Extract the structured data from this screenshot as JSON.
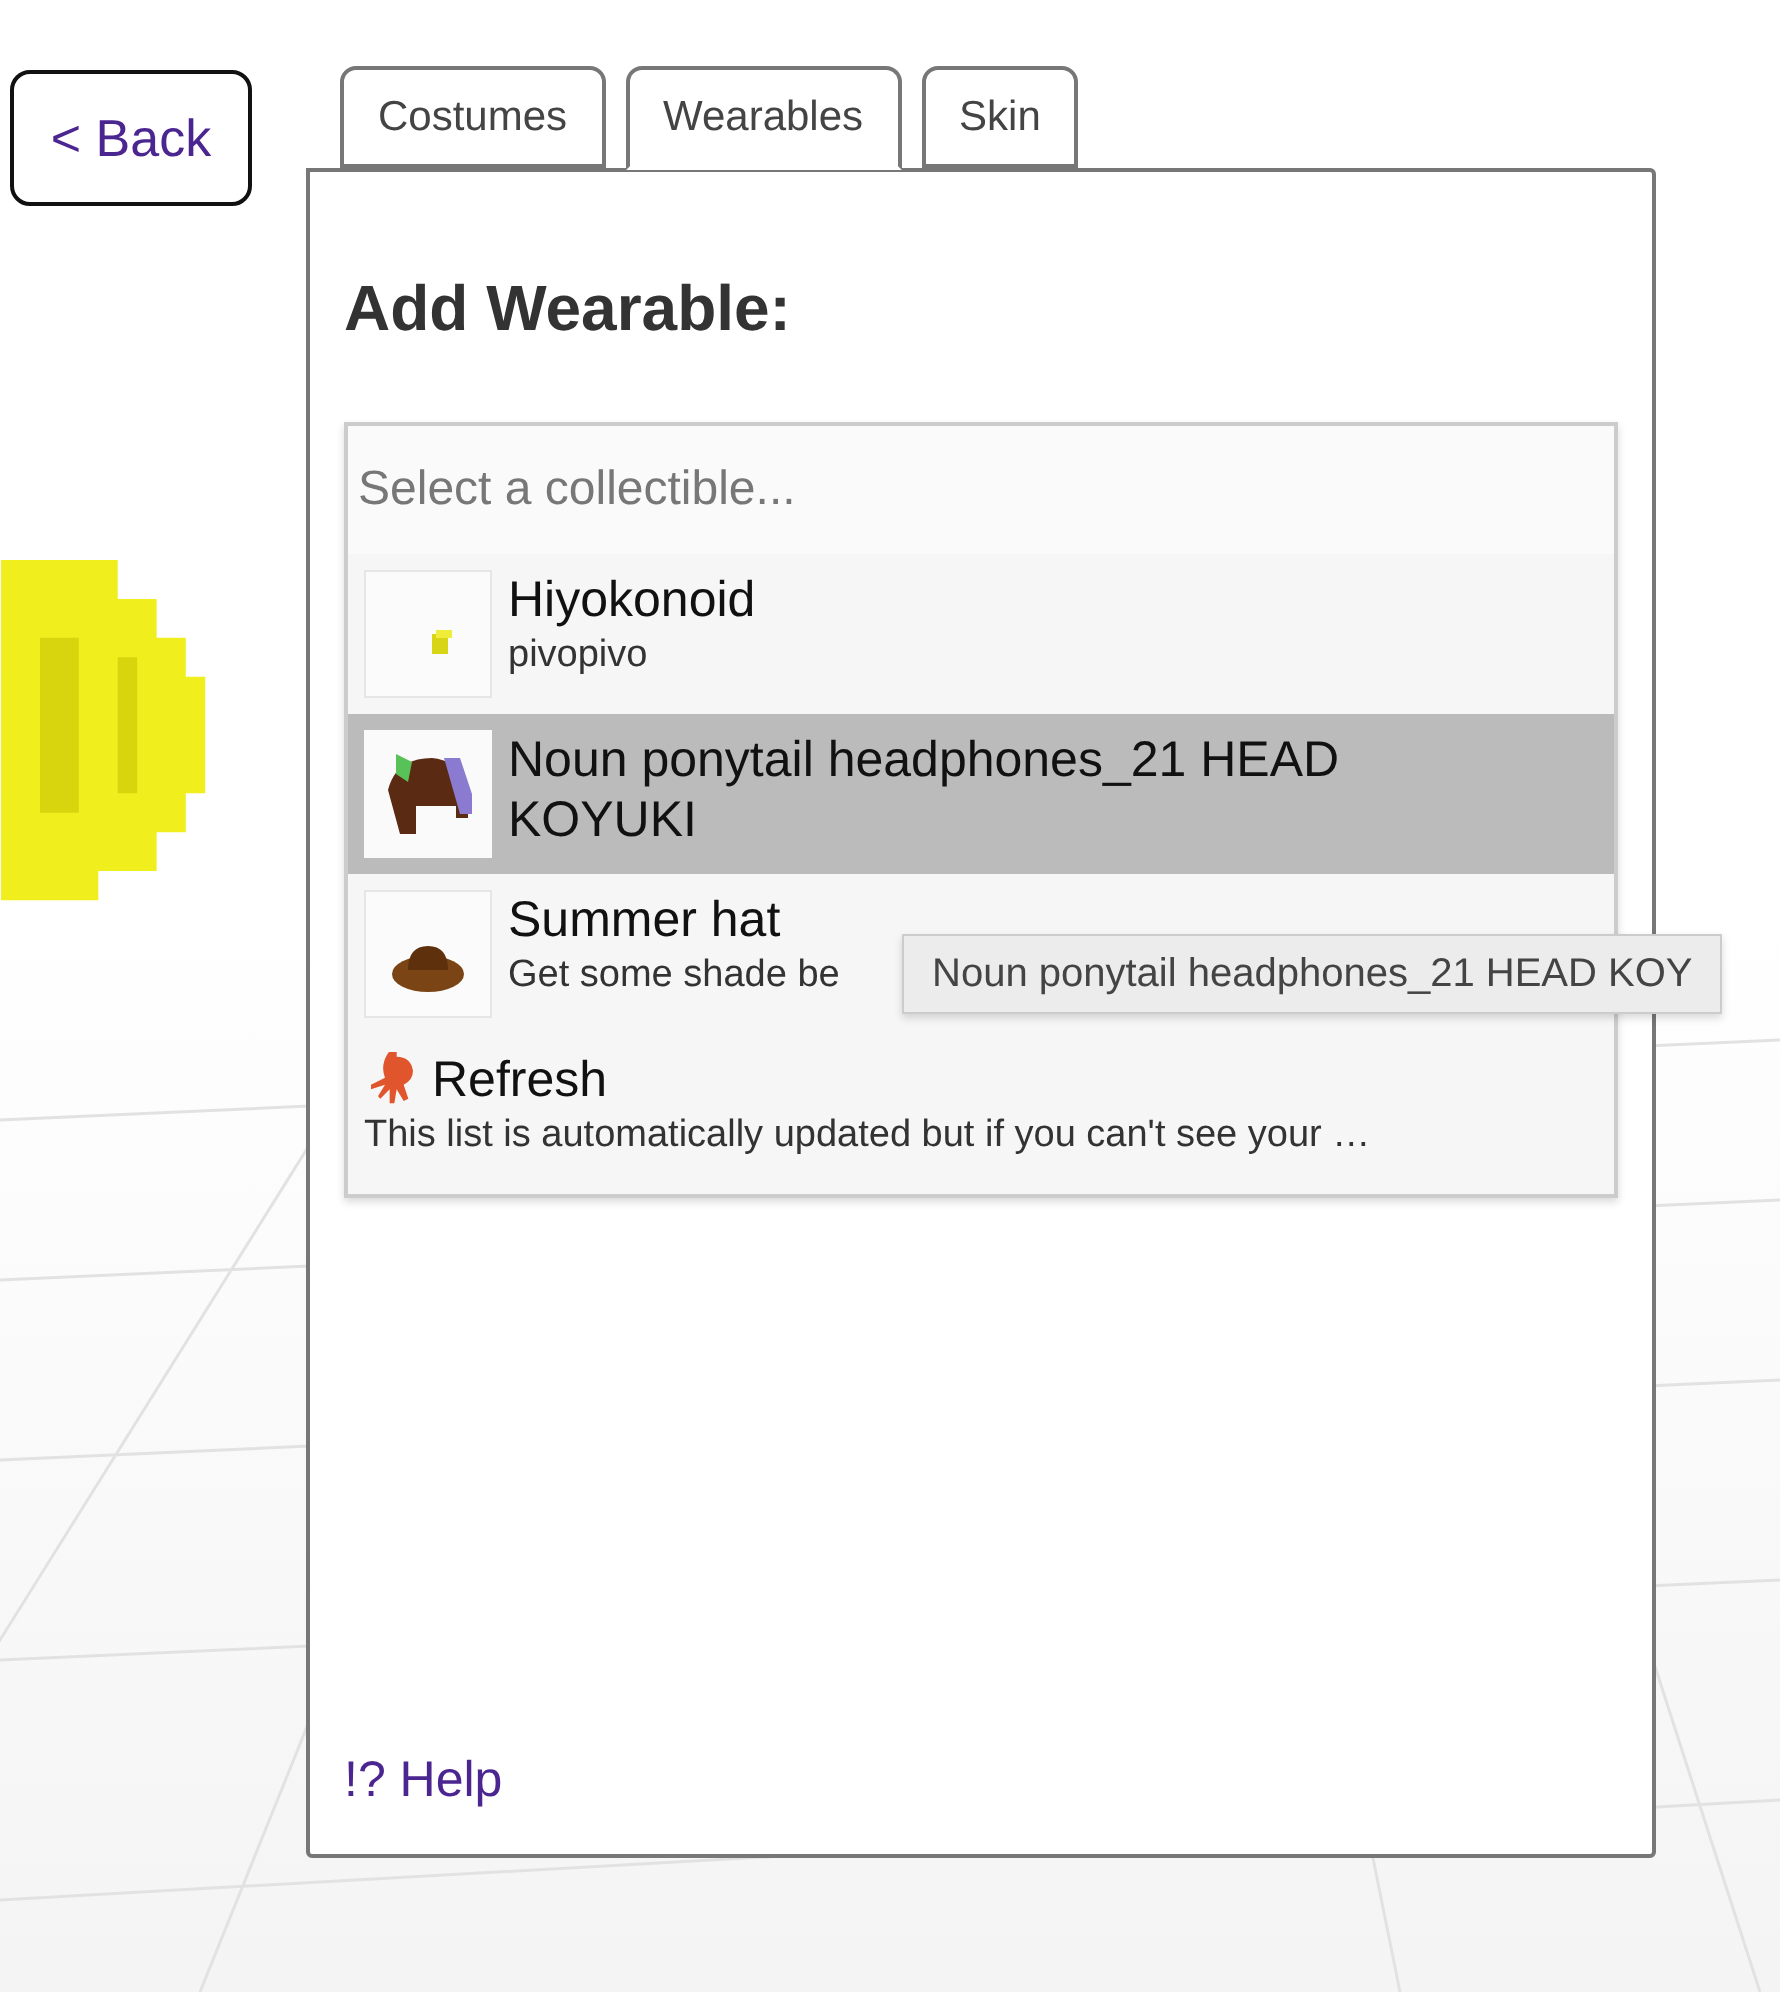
{
  "back_button": {
    "label": "< Back"
  },
  "tabs": [
    {
      "label": "Costumes",
      "selected": false
    },
    {
      "label": "Wearables",
      "selected": true
    },
    {
      "label": "Skin",
      "selected": false
    }
  ],
  "heading": "Add Wearable:",
  "collectible_select": {
    "placeholder": "Select a collectible...",
    "options": [
      {
        "kind": "item",
        "title": "Hiyokonoid",
        "description": "pivopivo",
        "selected": false
      },
      {
        "kind": "item",
        "title": "Noun ponytail headphones_21 HEAD KOYUKI",
        "selected": true
      },
      {
        "kind": "item",
        "title": "Summer hat",
        "description": "Get some shade be",
        "selected": false
      },
      {
        "kind": "action",
        "title": "Refresh",
        "description": "This list is automatically updated but if you can't see your …",
        "selected": false
      }
    ]
  },
  "tooltip": "Noun ponytail headphones_21 HEAD KOY",
  "help_link": "!? Help"
}
